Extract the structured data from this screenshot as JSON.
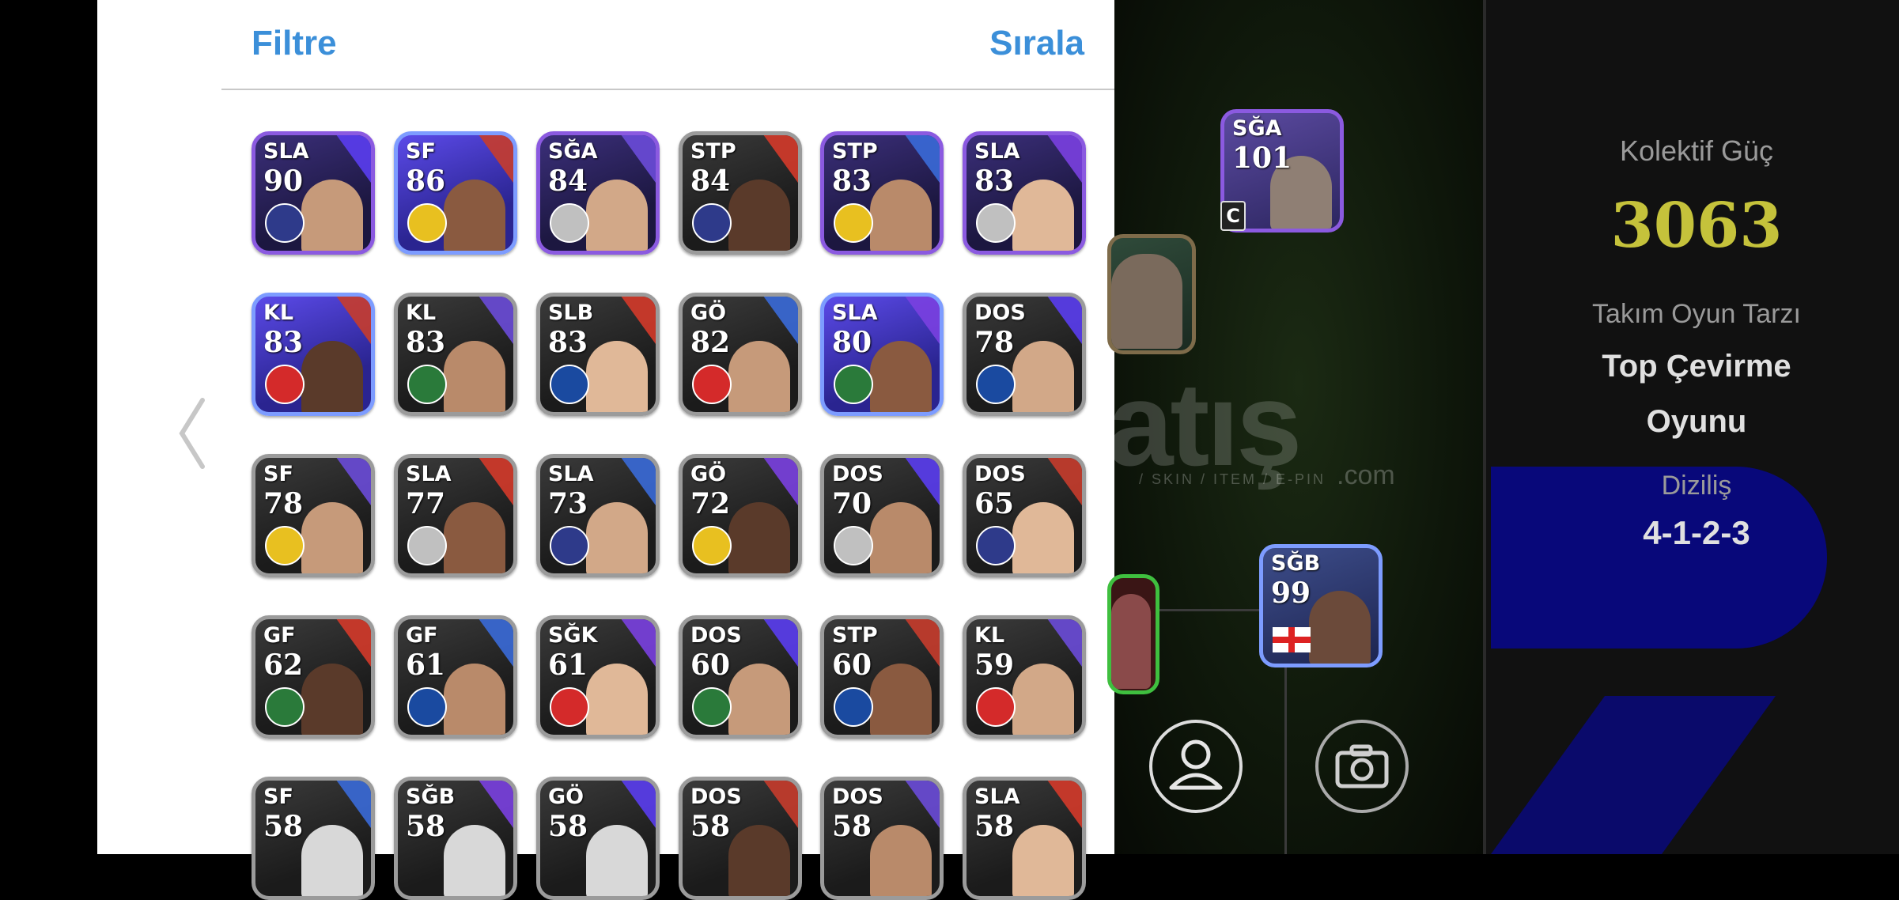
{
  "header": {
    "filter_label": "Filtre",
    "sort_label": "Sırala"
  },
  "players": [
    [
      {
        "pos": "SLA",
        "rating": "90",
        "style": "purple"
      },
      {
        "pos": "SF",
        "rating": "86",
        "style": "blue"
      },
      {
        "pos": "SĞA",
        "rating": "84",
        "style": "purple"
      },
      {
        "pos": "STP",
        "rating": "84",
        "style": "grey"
      },
      {
        "pos": "STP",
        "rating": "83",
        "style": "purple"
      },
      {
        "pos": "SLA",
        "rating": "83",
        "style": "purple"
      }
    ],
    [
      {
        "pos": "KL",
        "rating": "83",
        "style": "blue"
      },
      {
        "pos": "KL",
        "rating": "83",
        "style": "grey"
      },
      {
        "pos": "SLB",
        "rating": "83",
        "style": "grey"
      },
      {
        "pos": "GÖ",
        "rating": "82",
        "style": "grey"
      },
      {
        "pos": "SLA",
        "rating": "80",
        "style": "blue"
      },
      {
        "pos": "DOS",
        "rating": "78",
        "style": "grey"
      }
    ],
    [
      {
        "pos": "SF",
        "rating": "78",
        "style": "grey"
      },
      {
        "pos": "SLA",
        "rating": "77",
        "style": "grey"
      },
      {
        "pos": "SLA",
        "rating": "73",
        "style": "grey"
      },
      {
        "pos": "GÖ",
        "rating": "72",
        "style": "grey"
      },
      {
        "pos": "DOS",
        "rating": "70",
        "style": "grey"
      },
      {
        "pos": "DOS",
        "rating": "65",
        "style": "grey"
      }
    ],
    [
      {
        "pos": "GF",
        "rating": "62",
        "style": "grey"
      },
      {
        "pos": "GF",
        "rating": "61",
        "style": "grey"
      },
      {
        "pos": "SĞK",
        "rating": "61",
        "style": "grey"
      },
      {
        "pos": "DOS",
        "rating": "60",
        "style": "grey"
      },
      {
        "pos": "STP",
        "rating": "60",
        "style": "grey"
      },
      {
        "pos": "KL",
        "rating": "59",
        "style": "grey"
      }
    ],
    [
      {
        "pos": "SF",
        "rating": "58",
        "style": "grey"
      },
      {
        "pos": "SĞB",
        "rating": "58",
        "style": "grey"
      },
      {
        "pos": "GÖ",
        "rating": "58",
        "style": "grey"
      },
      {
        "pos": "DOS",
        "rating": "58",
        "style": "grey"
      },
      {
        "pos": "DOS",
        "rating": "58",
        "style": "grey"
      },
      {
        "pos": "SLA",
        "rating": "58",
        "style": "grey"
      }
    ]
  ],
  "pitch": {
    "card_top": {
      "pos": "SĞA",
      "rating": "101",
      "captain": "C"
    },
    "card_right": {
      "pos": "SĞB",
      "rating": "99"
    },
    "watermark_sub": "/ SKIN / ITEM / E-PIN",
    "watermark_com": ".com",
    "icons": [
      "user-icon",
      "camera-icon"
    ]
  },
  "info": {
    "power_label": "Kolektif Güç",
    "power_value": "3063",
    "style_label": "Takım Oyun Tarzı",
    "style_value": "Top Çevirme Oyunu",
    "formation_label": "Diziliş",
    "formation_value": "4-1-2-3"
  },
  "colors": {
    "accent": "#3b8fd9",
    "power": "#c5c23b",
    "purple_frame": "#8b5ae0",
    "blue_frame": "#7d9cff"
  }
}
